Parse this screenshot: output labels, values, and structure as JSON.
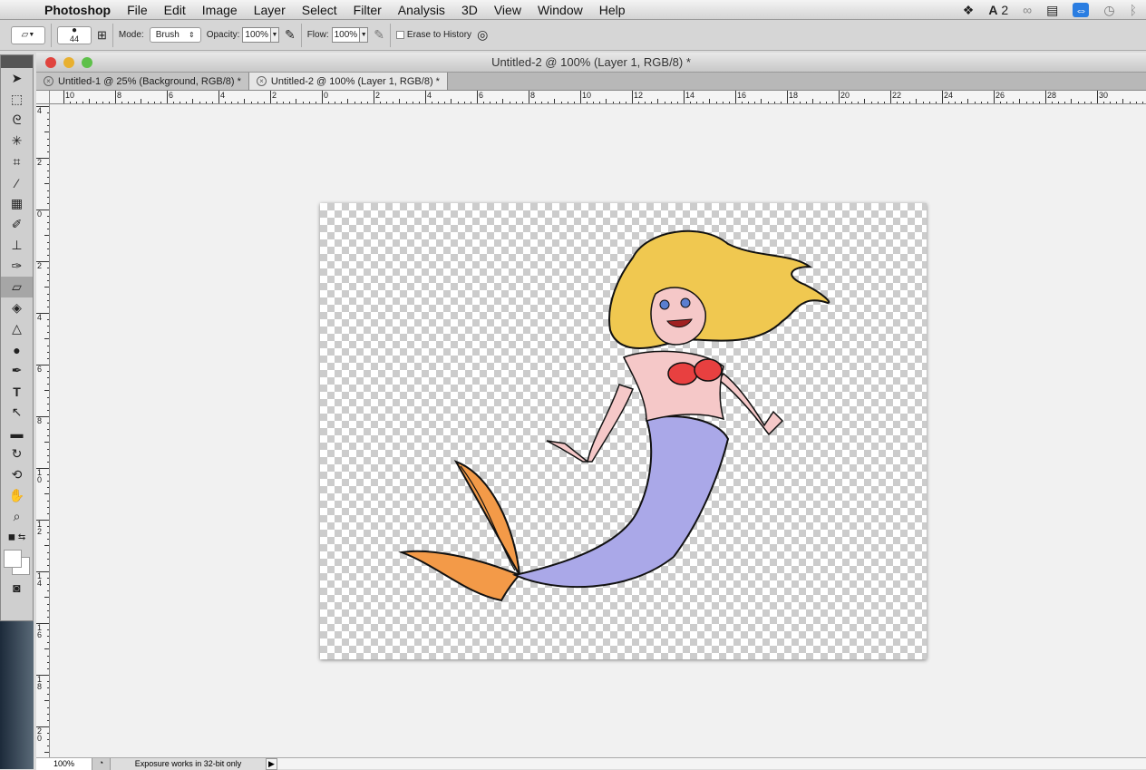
{
  "menubar": {
    "app": "Photoshop",
    "items": [
      "File",
      "Edit",
      "Image",
      "Layer",
      "Select",
      "Filter",
      "Analysis",
      "3D",
      "View",
      "Window",
      "Help"
    ],
    "adobe_count": "2"
  },
  "options": {
    "brush_size": "44",
    "mode_label": "Mode:",
    "mode_value": "Brush",
    "opacity_label": "Opacity:",
    "opacity_value": "100%",
    "flow_label": "Flow:",
    "flow_value": "100%",
    "erase_history_label": "Erase to History",
    "erase_history_checked": false
  },
  "document": {
    "title": "Untitled-2 @ 100% (Layer 1, RGB/8) *",
    "tabs": [
      {
        "label": "Untitled-1 @ 25% (Background, RGB/8) *",
        "active": false
      },
      {
        "label": "Untitled-2 @ 100% (Layer 1, RGB/8) *",
        "active": true
      }
    ]
  },
  "ruler": {
    "h_labels": [
      "10",
      "8",
      "6",
      "4",
      "2",
      "0",
      "2",
      "4",
      "6",
      "8",
      "10",
      "12",
      "14",
      "16",
      "18",
      "20",
      "22",
      "24",
      "26",
      "28",
      "30"
    ],
    "v_labels": [
      "4",
      "2",
      "0",
      "2",
      "4",
      "6",
      "8",
      "10",
      "12",
      "14",
      "16",
      "18",
      "20"
    ]
  },
  "status": {
    "zoom": "100%",
    "message": "Exposure works in 32-bit only"
  },
  "colors": {
    "hair": "#f0c850",
    "skin": "#f5c8c8",
    "bikini": "#e84040",
    "tail": "#aaa8e8",
    "fin": "#f39a48"
  }
}
